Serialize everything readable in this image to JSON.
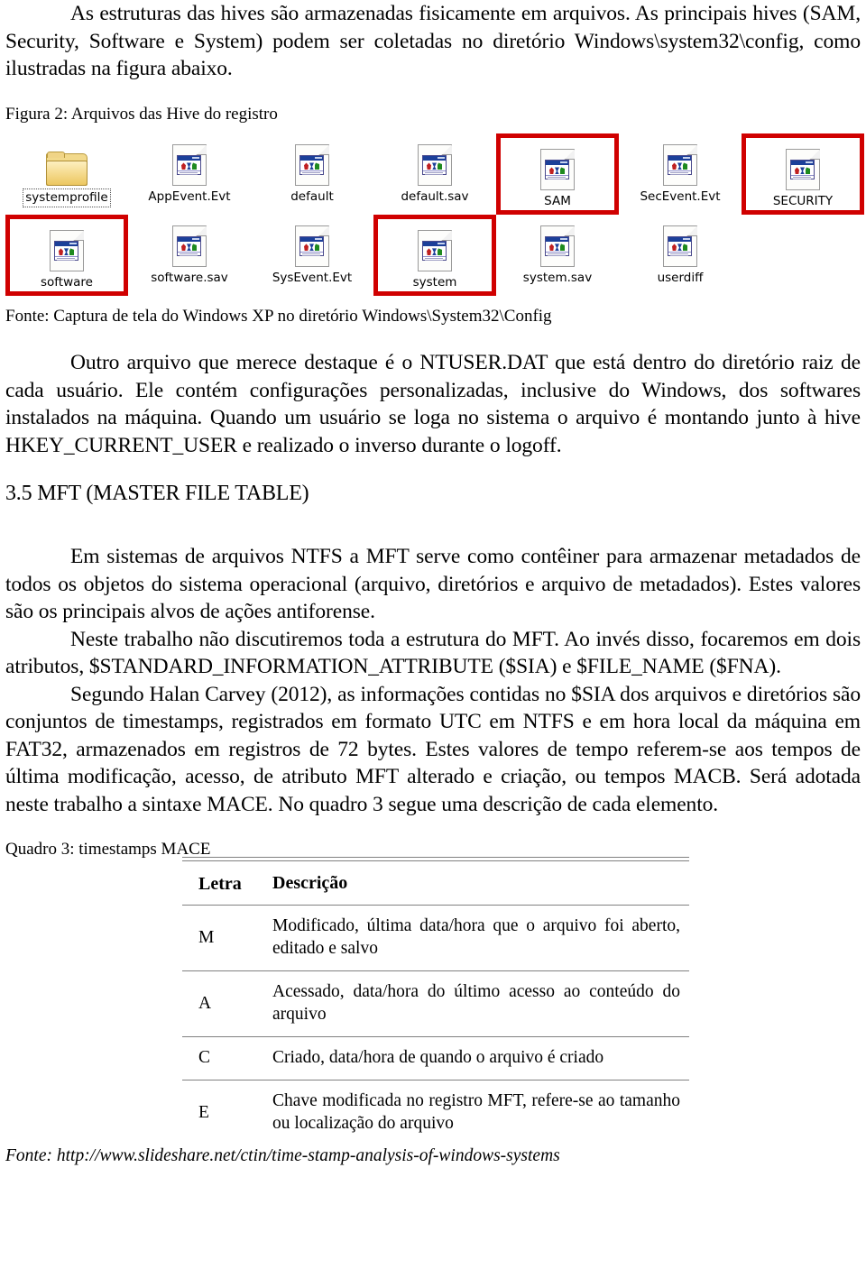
{
  "document": {
    "paragraph_intro": "As estruturas das hives são armazenadas fisicamente em arquivos. As principais hives (SAM, Security, Software e System) podem ser coletadas no diretório Windows\\system32\\config, como ilustradas na figura abaixo.",
    "figure_caption": "Figura 2: Arquivos das Hive do registro",
    "figure_source": "Fonte: Captura de tela do Windows XP no diretório Windows\\System32\\Config",
    "paragraph_ntuser": "Outro arquivo que merece destaque é o NTUSER.DAT que está dentro do diretório raiz de cada usuário. Ele contém configurações personalizadas, inclusive do Windows, dos softwares instalados na máquina. Quando um usuário se loga no sistema o arquivo é montando junto à hive HKEY_CURRENT_USER e realizado o inverso durante o logoff.",
    "section_heading": "3.5 MFT (MASTER FILE TABLE)",
    "paragraph_mft_1": "Em sistemas de arquivos NTFS a MFT serve como contêiner para armazenar metadados de todos os objetos do sistema operacional (arquivo, diretórios e arquivo de metadados). Estes valores são os principais alvos de ações antiforense.",
    "paragraph_mft_2": "Neste trabalho não discutiremos toda a estrutura do MFT. Ao invés disso, focaremos em dois atributos, $STANDARD_INFORMATION_ATTRIBUTE ($SIA) e $FILE_NAME ($FNA).",
    "paragraph_mft_3": "Segundo Halan Carvey (2012), as informações contidas no $SIA dos arquivos e diretórios são conjuntos de timestamps, registrados em formato UTC em NTFS e em hora local da máquina em FAT32, armazenados em registros de 72 bytes. Estes valores de tempo referem-se aos tempos de última modificação, acesso, de atributo MFT alterado e criação, ou tempos MACB. Será adotada neste trabalho a sintaxe MACE. No quadro 3 segue uma descrição de cada elemento.",
    "quadro_caption": "Quadro 3: timestamps MACE",
    "fonte_bottom": "Fonte: http://www.slideshare.net/ctin/time-stamp-analysis-of-windows-systems"
  },
  "figure_icons": {
    "highlight_color": "#d00000",
    "rows": [
      [
        {
          "label": "systemprofile",
          "icon": "folder-icon",
          "highlighted": false,
          "selected": true
        },
        {
          "label": "AppEvent.Evt",
          "icon": "registry-file-icon",
          "highlighted": false,
          "selected": false
        },
        {
          "label": "default",
          "icon": "registry-file-icon",
          "highlighted": false,
          "selected": false
        },
        {
          "label": "default.sav",
          "icon": "registry-file-icon",
          "highlighted": false,
          "selected": false
        },
        {
          "label": "SAM",
          "icon": "registry-file-icon",
          "highlighted": true,
          "selected": false
        },
        {
          "label": "SecEvent.Evt",
          "icon": "registry-file-icon",
          "highlighted": false,
          "selected": false
        },
        {
          "label": "SECURITY",
          "icon": "registry-file-icon",
          "highlighted": true,
          "selected": false
        }
      ],
      [
        {
          "label": "software",
          "icon": "registry-file-icon",
          "highlighted": true,
          "selected": false
        },
        {
          "label": "software.sav",
          "icon": "registry-file-icon",
          "highlighted": false,
          "selected": false
        },
        {
          "label": "SysEvent.Evt",
          "icon": "registry-file-icon",
          "highlighted": false,
          "selected": false
        },
        {
          "label": "system",
          "icon": "registry-file-icon",
          "highlighted": true,
          "selected": false
        },
        {
          "label": "system.sav",
          "icon": "registry-file-icon",
          "highlighted": false,
          "selected": false
        },
        {
          "label": "userdiff",
          "icon": "registry-file-icon",
          "highlighted": false,
          "selected": false
        }
      ]
    ]
  },
  "mace_table": {
    "headers": [
      "Letra",
      "Descrição"
    ],
    "rows": [
      {
        "letra": "M",
        "descricao": "Modificado, última data/hora que o arquivo foi aberto, editado e salvo"
      },
      {
        "letra": "A",
        "descricao": "Acessado, data/hora do último acesso ao conteúdo do arquivo"
      },
      {
        "letra": "C",
        "descricao": "Criado, data/hora de quando o arquivo é criado"
      },
      {
        "letra": "E",
        "descricao": "Chave modificada no registro MFT, refere-se ao tamanho ou localização do arquivo"
      }
    ]
  }
}
